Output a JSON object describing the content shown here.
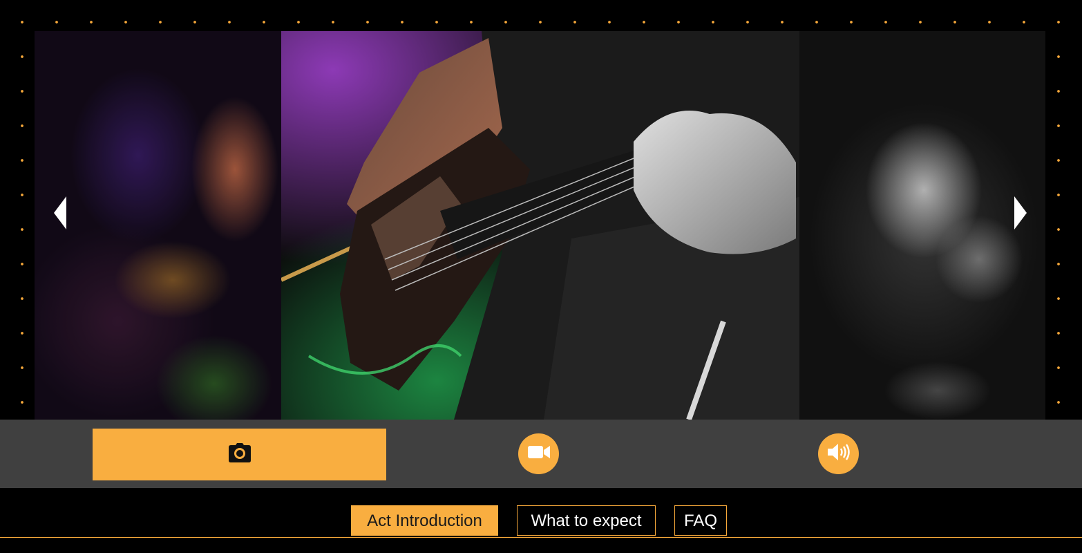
{
  "gallery": {
    "prev_icon": "chevron-left-icon",
    "next_icon": "chevron-right-icon",
    "slides": [
      {
        "position": "previous",
        "content": "blurred live band photo"
      },
      {
        "position": "current",
        "content": "bass guitarist playing on stage"
      },
      {
        "position": "next",
        "content": "blurred black and white photo"
      }
    ]
  },
  "media_bar": {
    "tabs": [
      {
        "icon": "camera-icon",
        "active": true
      },
      {
        "icon": "video-camera-icon",
        "active": false
      },
      {
        "icon": "speaker-icon",
        "active": false
      }
    ]
  },
  "info_tabs": {
    "items": [
      {
        "label": "Act Introduction",
        "active": true
      },
      {
        "label": "What to expect",
        "active": false
      },
      {
        "label": "FAQ",
        "active": false
      }
    ]
  },
  "colors": {
    "accent": "#f9ae40",
    "media_bar_bg": "#404040",
    "page_bg": "#000000"
  }
}
